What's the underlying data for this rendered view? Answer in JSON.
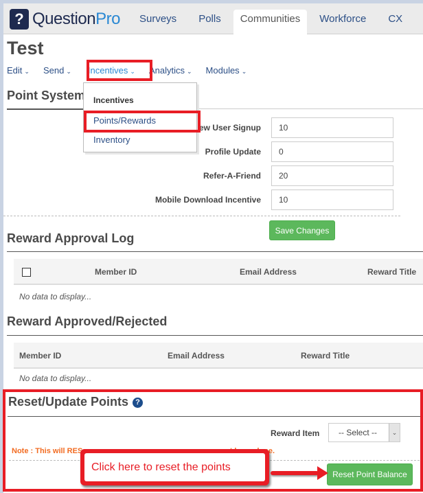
{
  "header": {
    "logo_mark": "?",
    "logo_text_main": "Question",
    "logo_text_accent": "Pro",
    "tabs": [
      {
        "label": "Surveys",
        "active": false
      },
      {
        "label": "Polls",
        "active": false
      },
      {
        "label": "Communities",
        "active": true
      },
      {
        "label": "Workforce",
        "active": false
      },
      {
        "label": "CX",
        "active": false
      }
    ]
  },
  "page": {
    "title": "Test",
    "subnav": [
      {
        "label": "Edit",
        "chevron": "⌄"
      },
      {
        "label": "Send",
        "chevron": "⌄"
      },
      {
        "label": "Incentives",
        "chevron": "⌄",
        "active": true
      },
      {
        "label": "Analytics",
        "chevron": "⌄"
      },
      {
        "label": "Modules",
        "chevron": "⌄"
      }
    ]
  },
  "incentives_dropdown": {
    "heading": "Incentives",
    "items": [
      "Points/Rewards",
      "Inventory"
    ]
  },
  "point_system": {
    "title": "Point System",
    "fields": [
      {
        "label": "New User Signup",
        "value": "10"
      },
      {
        "label": "Profile Update",
        "value": "0"
      },
      {
        "label": "Refer-A-Friend",
        "value": "20"
      },
      {
        "label": "Mobile Download Incentive",
        "value": "10"
      }
    ],
    "save_label": "Save Changes"
  },
  "reward_approval_log": {
    "title": "Reward Approval Log",
    "columns": [
      "Member ID",
      "Email Address",
      "Reward Title"
    ],
    "empty_text": "No data to display..."
  },
  "reward_approved_rejected": {
    "title": "Reward Approved/Rejected",
    "columns": [
      "Member ID",
      "Email Address",
      "Reward Title"
    ],
    "empty_text": "No data to display..."
  },
  "reset_points": {
    "title": "Reset/Update Points",
    "help_icon": "?",
    "reward_item_label": "Reward Item",
    "select_value": "-- Select --",
    "select_caret": "⌄",
    "note_visible_left": "Note : This will RES",
    "note_visible_right": "cannot be undone.",
    "reset_button_label": "Reset Point Balance"
  },
  "annotation": {
    "callout_text": "Click here to reset the points",
    "highlight_color": "#e81d25"
  },
  "colors": {
    "brand_navy": "#1e2a4f",
    "brand_blue": "#2a88d3",
    "link": "#2c4f86",
    "success": "#5cb85c",
    "warning_text": "#f26b21"
  }
}
